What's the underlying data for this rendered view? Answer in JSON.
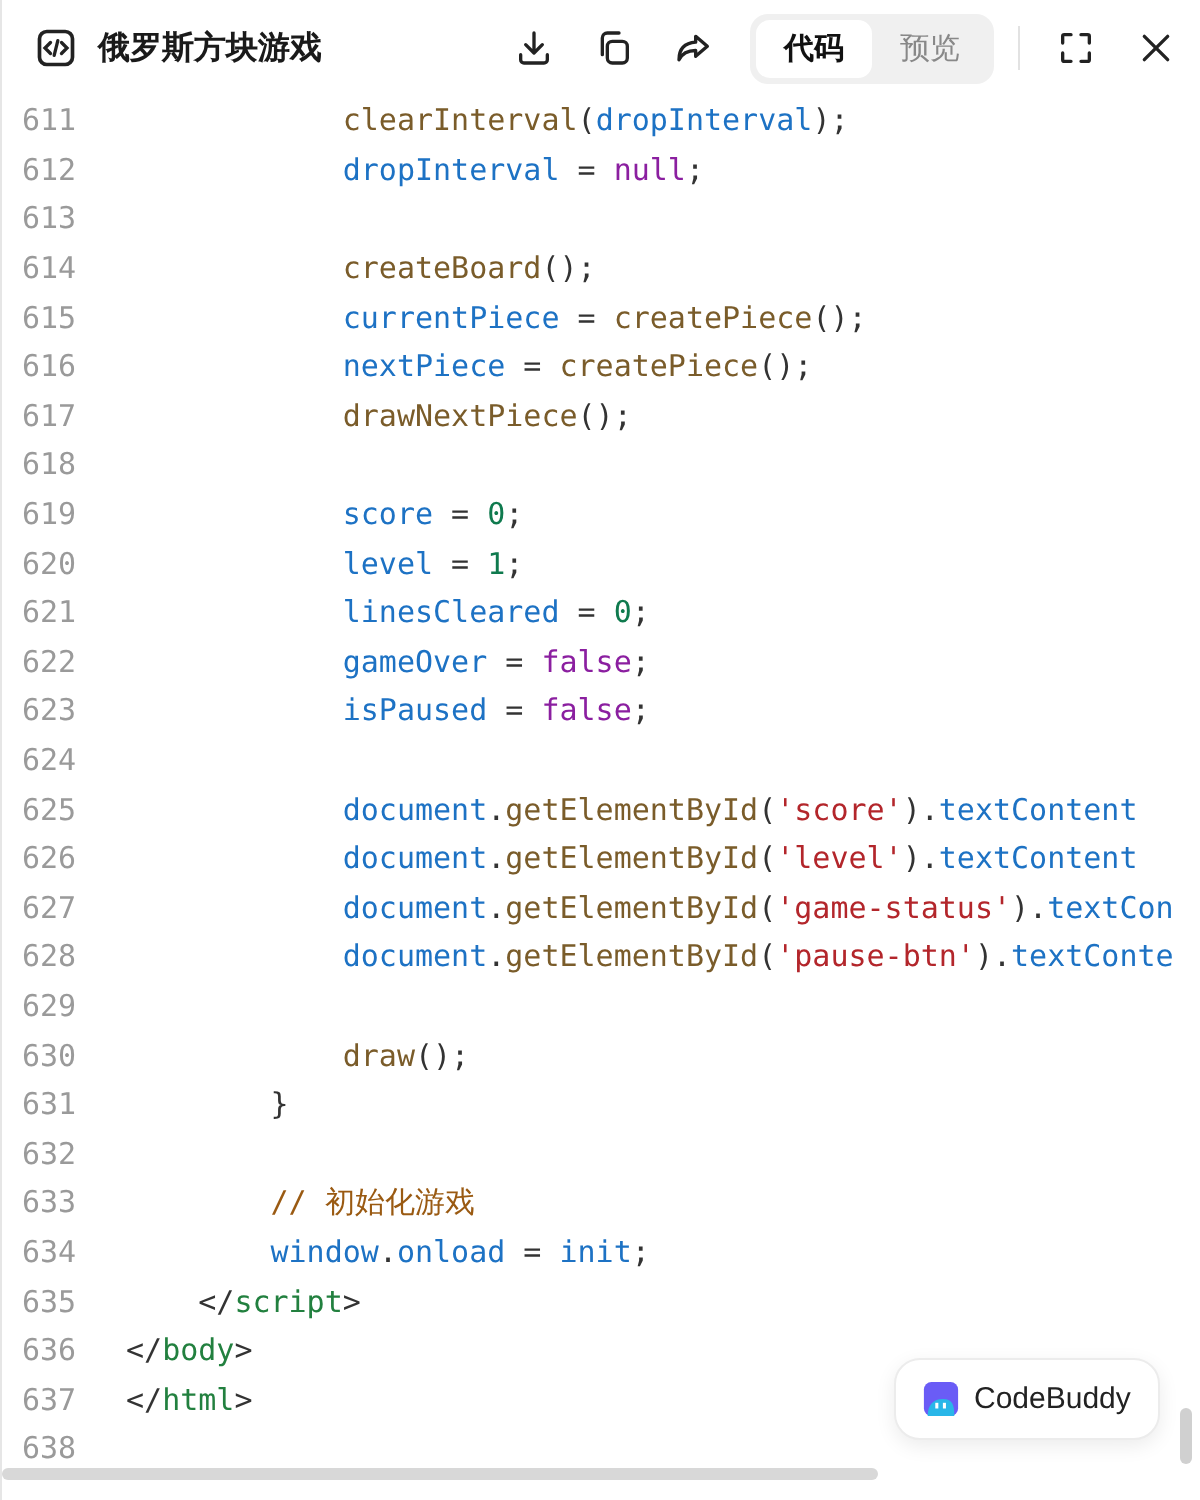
{
  "window": {
    "title": "俄罗斯方块游戏"
  },
  "tabs": [
    {
      "label": "代码",
      "selected": true
    },
    {
      "label": "预览",
      "selected": false
    }
  ],
  "code_lines": [
    {
      "number": "611",
      "tokens": [
        {
          "kind": "fn",
          "text": "            clearInterval"
        },
        {
          "kind": "plain",
          "text": "("
        },
        {
          "kind": "var",
          "text": "dropInterval"
        },
        {
          "kind": "plain",
          "text": ");"
        }
      ]
    },
    {
      "number": "612",
      "tokens": [
        {
          "kind": "var",
          "text": "            dropInterval"
        },
        {
          "kind": "plain",
          "text": " = "
        },
        {
          "kind": "keyword",
          "text": "null"
        },
        {
          "kind": "plain",
          "text": ";"
        }
      ]
    },
    {
      "number": "613"
    },
    {
      "number": "614",
      "tokens": [
        {
          "kind": "fn",
          "text": "            createBoard"
        },
        {
          "kind": "plain",
          "text": "();"
        }
      ]
    },
    {
      "number": "615",
      "tokens": [
        {
          "kind": "var",
          "text": "            currentPiece"
        },
        {
          "kind": "plain",
          "text": " = "
        },
        {
          "kind": "fn",
          "text": "createPiece"
        },
        {
          "kind": "plain",
          "text": "();"
        }
      ]
    },
    {
      "number": "616",
      "tokens": [
        {
          "kind": "var",
          "text": "            nextPiece"
        },
        {
          "kind": "plain",
          "text": " = "
        },
        {
          "kind": "fn",
          "text": "createPiece"
        },
        {
          "kind": "plain",
          "text": "();"
        }
      ]
    },
    {
      "number": "617",
      "tokens": [
        {
          "kind": "fn",
          "text": "            drawNextPiece"
        },
        {
          "kind": "plain",
          "text": "();"
        }
      ]
    },
    {
      "number": "618"
    },
    {
      "number": "619",
      "tokens": [
        {
          "kind": "var",
          "text": "            score"
        },
        {
          "kind": "plain",
          "text": " = "
        },
        {
          "kind": "number",
          "text": "0"
        },
        {
          "kind": "plain",
          "text": ";"
        }
      ]
    },
    {
      "number": "620",
      "tokens": [
        {
          "kind": "var",
          "text": "            level"
        },
        {
          "kind": "plain",
          "text": " = "
        },
        {
          "kind": "number",
          "text": "1"
        },
        {
          "kind": "plain",
          "text": ";"
        }
      ]
    },
    {
      "number": "621",
      "tokens": [
        {
          "kind": "var",
          "text": "            linesCleared"
        },
        {
          "kind": "plain",
          "text": " = "
        },
        {
          "kind": "number",
          "text": "0"
        },
        {
          "kind": "plain",
          "text": ";"
        }
      ]
    },
    {
      "number": "622",
      "tokens": [
        {
          "kind": "var",
          "text": "            gameOver"
        },
        {
          "kind": "plain",
          "text": " = "
        },
        {
          "kind": "keyword",
          "text": "false"
        },
        {
          "kind": "plain",
          "text": ";"
        }
      ]
    },
    {
      "number": "623",
      "tokens": [
        {
          "kind": "var",
          "text": "            isPaused"
        },
        {
          "kind": "plain",
          "text": " = "
        },
        {
          "kind": "keyword",
          "text": "false"
        },
        {
          "kind": "plain",
          "text": ";"
        }
      ]
    },
    {
      "number": "624"
    },
    {
      "number": "625",
      "tokens": [
        {
          "kind": "var",
          "text": "            document"
        },
        {
          "kind": "plain",
          "text": "."
        },
        {
          "kind": "fn",
          "text": "getElementById"
        },
        {
          "kind": "plain",
          "text": "("
        },
        {
          "kind": "string",
          "text": "'score'"
        },
        {
          "kind": "plain",
          "text": ")."
        },
        {
          "kind": "var",
          "text": "textContent"
        }
      ]
    },
    {
      "number": "626",
      "tokens": [
        {
          "kind": "var",
          "text": "            document"
        },
        {
          "kind": "plain",
          "text": "."
        },
        {
          "kind": "fn",
          "text": "getElementById"
        },
        {
          "kind": "plain",
          "text": "("
        },
        {
          "kind": "string",
          "text": "'level'"
        },
        {
          "kind": "plain",
          "text": ")."
        },
        {
          "kind": "var",
          "text": "textContent"
        }
      ]
    },
    {
      "number": "627",
      "tokens": [
        {
          "kind": "var",
          "text": "            document"
        },
        {
          "kind": "plain",
          "text": "."
        },
        {
          "kind": "fn",
          "text": "getElementById"
        },
        {
          "kind": "plain",
          "text": "("
        },
        {
          "kind": "string",
          "text": "'game-status'"
        },
        {
          "kind": "plain",
          "text": ")."
        },
        {
          "kind": "var",
          "text": "textCon"
        }
      ]
    },
    {
      "number": "628",
      "tokens": [
        {
          "kind": "var",
          "text": "            document"
        },
        {
          "kind": "plain",
          "text": "."
        },
        {
          "kind": "fn",
          "text": "getElementById"
        },
        {
          "kind": "plain",
          "text": "("
        },
        {
          "kind": "string",
          "text": "'pause-btn'"
        },
        {
          "kind": "plain",
          "text": ")."
        },
        {
          "kind": "var",
          "text": "textConte"
        }
      ]
    },
    {
      "number": "629"
    },
    {
      "number": "630",
      "tokens": [
        {
          "kind": "fn",
          "text": "            draw"
        },
        {
          "kind": "plain",
          "text": "();"
        }
      ]
    },
    {
      "number": "631",
      "tokens": [
        {
          "kind": "plain",
          "text": "        }"
        }
      ]
    },
    {
      "number": "632"
    },
    {
      "number": "633",
      "tokens": [
        {
          "kind": "comment",
          "text": "        // 初始化游戏"
        }
      ]
    },
    {
      "number": "634",
      "tokens": [
        {
          "kind": "var",
          "text": "        window"
        },
        {
          "kind": "plain",
          "text": "."
        },
        {
          "kind": "var",
          "text": "onload"
        },
        {
          "kind": "plain",
          "text": " = "
        },
        {
          "kind": "var",
          "text": "init"
        },
        {
          "kind": "plain",
          "text": ";"
        }
      ]
    },
    {
      "number": "635",
      "tokens": [
        {
          "kind": "plain",
          "text": "    </"
        },
        {
          "kind": "tag",
          "text": "script"
        },
        {
          "kind": "plain",
          "text": ">"
        }
      ]
    },
    {
      "number": "636",
      "tokens": [
        {
          "kind": "plain",
          "text": "</"
        },
        {
          "kind": "tag",
          "text": "body"
        },
        {
          "kind": "plain",
          "text": ">"
        }
      ]
    },
    {
      "number": "637",
      "tokens": [
        {
          "kind": "plain",
          "text": "</"
        },
        {
          "kind": "tag",
          "text": "html"
        },
        {
          "kind": "plain",
          "text": ">"
        }
      ]
    },
    {
      "number": "638"
    }
  ],
  "assistant_button": {
    "label": "CodeBuddy"
  }
}
